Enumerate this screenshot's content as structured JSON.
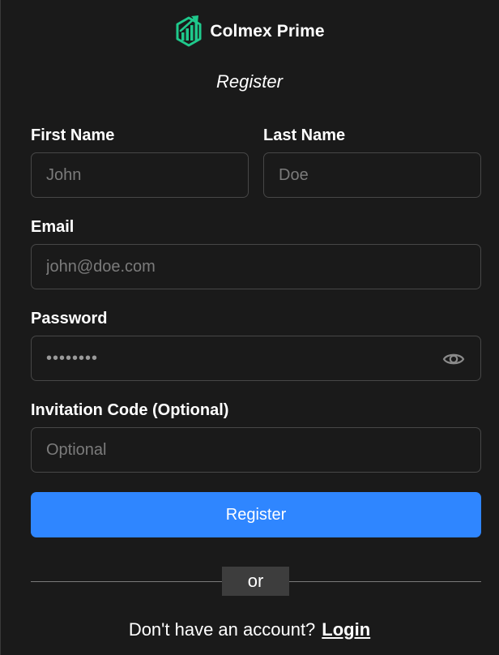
{
  "brand": {
    "name": "Colmex Prime",
    "icon": "bar-chart-growth-logo",
    "accent_color": "#1fc98c"
  },
  "form": {
    "title": "Register",
    "first_name": {
      "label": "First Name",
      "placeholder": "John",
      "value": ""
    },
    "last_name": {
      "label": "Last Name",
      "placeholder": "Doe",
      "value": ""
    },
    "email": {
      "label": "Email",
      "placeholder": "john@doe.com",
      "value": ""
    },
    "password": {
      "label": "Password",
      "masked_value": "••••••••",
      "toggle_icon": "eye-icon"
    },
    "invitation_code": {
      "label": "Invitation Code (Optional)",
      "placeholder": "Optional",
      "value": ""
    },
    "submit_label": "Register",
    "submit_color": "#2f86ff"
  },
  "divider": {
    "label": "or"
  },
  "footer": {
    "prompt": "Don't have an account?",
    "link_label": "Login"
  }
}
